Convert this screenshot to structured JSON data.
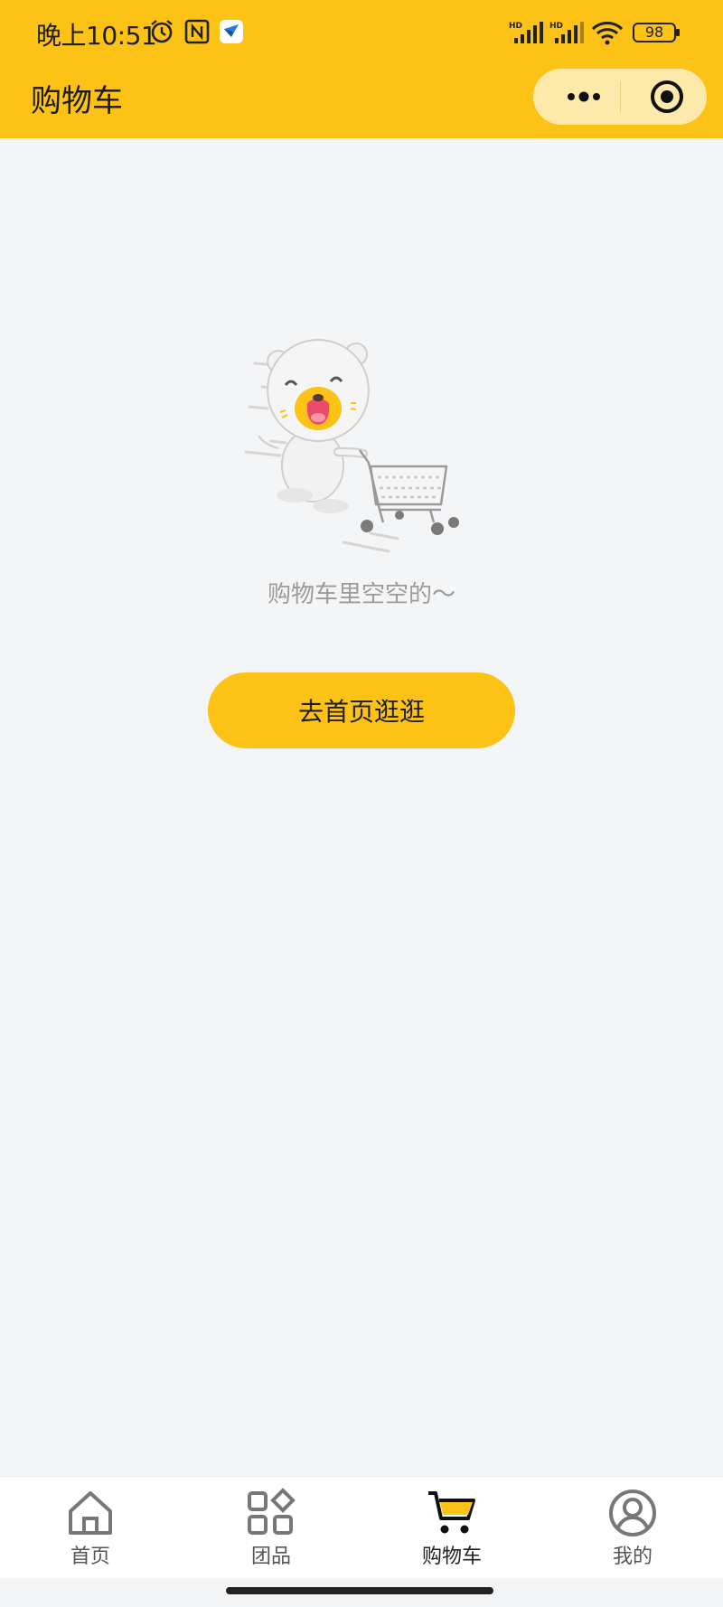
{
  "status_bar": {
    "time": "晚上10:51",
    "battery": "98",
    "network_labels": [
      "HD",
      "HD"
    ]
  },
  "nav": {
    "title": "购物车"
  },
  "empty_state": {
    "message": "购物车里空空的～",
    "button_label": "去首页逛逛"
  },
  "tabbar": {
    "items": [
      {
        "label": "首页",
        "icon": "home-icon",
        "active": false
      },
      {
        "label": "团品",
        "icon": "category-grid-icon",
        "active": false
      },
      {
        "label": "购物车",
        "icon": "cart-icon",
        "active": true
      },
      {
        "label": "我的",
        "icon": "profile-icon",
        "active": false
      }
    ]
  },
  "colors": {
    "brand": "#fcc216",
    "background": "#f4f5f7",
    "capsule": "#fde9a9",
    "text_muted": "#9b9b9b"
  }
}
